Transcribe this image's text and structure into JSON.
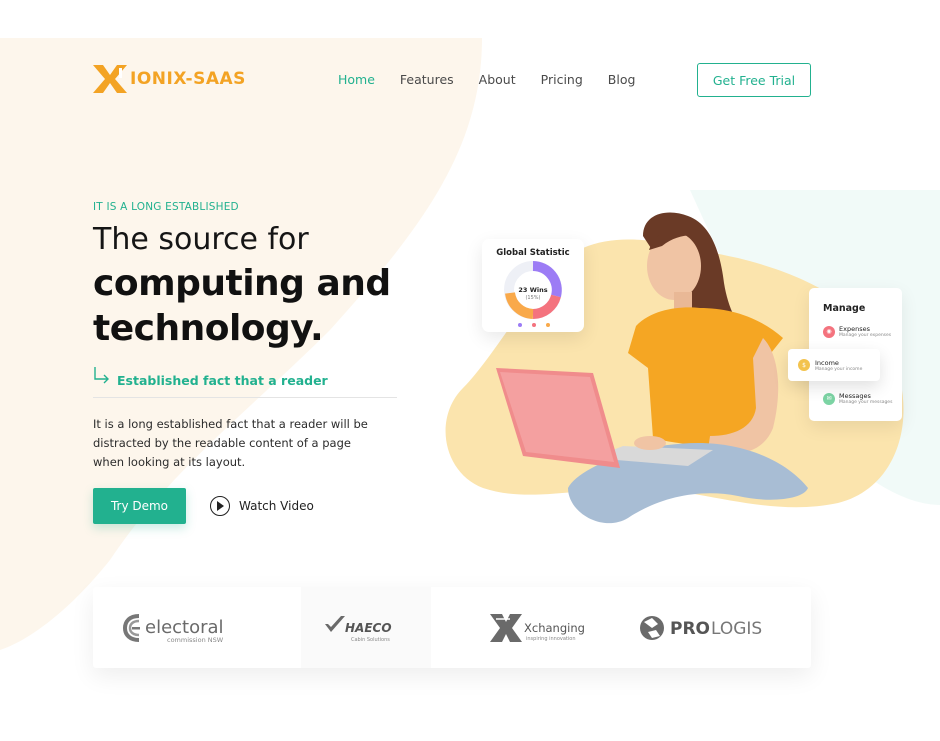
{
  "brand": {
    "name": "IONIX-SAAS"
  },
  "nav": {
    "items": [
      {
        "label": "Home",
        "active": true
      },
      {
        "label": "Features",
        "active": false
      },
      {
        "label": "About",
        "active": false
      },
      {
        "label": "Pricing",
        "active": false
      },
      {
        "label": "Blog",
        "active": false
      }
    ],
    "cta": "Get Free Trial"
  },
  "hero": {
    "eyebrow": "IT IS A LONG ESTABLISHED",
    "title_line1": "The source for",
    "title_line2": "computing and",
    "title_line3": "technology.",
    "fact": "Established fact that a reader",
    "description": [
      "It is a long established fact that a reader will be",
      "distracted by the readable content of a page",
      "when looking at its layout."
    ],
    "primary_button": "Try Demo",
    "secondary_button": "Watch Video"
  },
  "stat_card": {
    "title": "Global Statistic",
    "center_value": "23 Wins",
    "center_sub": "(15%)"
  },
  "manage_card": {
    "title": "Manage",
    "items": [
      {
        "name": "Expenses",
        "sub": "Manage your expenses"
      },
      {
        "name": "Income",
        "sub": "Manage your income"
      },
      {
        "name": "Messages",
        "sub": "Manage your messages"
      }
    ]
  },
  "partners": {
    "electoral": {
      "name": "electoral",
      "sub": "commission NSW"
    },
    "haeco": {
      "name": "HAECO",
      "sub": "Cabin Solutions"
    },
    "xchanging": {
      "name": "Xchanging",
      "sub": "inspiring innovation"
    },
    "prologis": {
      "name_bold": "PRO",
      "name_light": "LOGIS"
    }
  },
  "colors": {
    "accent": "#22b18f",
    "brand": "#f3a324",
    "blob": "#fdf5ea",
    "hero_blob": "#fbe4ad"
  }
}
